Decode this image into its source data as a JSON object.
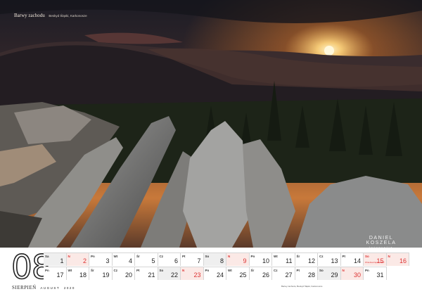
{
  "photo": {
    "caption_title": "Barwy zachodu",
    "caption_location": "Beskyd Śląski, Karkonosze",
    "author_name": "DANIEL KOSZELA",
    "author_role": "fotografia"
  },
  "calendar": {
    "month_number": "08",
    "month_name_pl": "SIERPIEŃ",
    "month_name_en": "AUGUST",
    "year": "2020",
    "row1": [
      {
        "wd": "Sa",
        "num": "1",
        "type": "sat"
      },
      {
        "wd": "N",
        "num": "2",
        "type": "sun"
      },
      {
        "wd": "Pn",
        "num": "3",
        "type": "wk"
      },
      {
        "wd": "Wt",
        "num": "4",
        "type": "wk"
      },
      {
        "wd": "Śr",
        "num": "5",
        "type": "wk"
      },
      {
        "wd": "Cz",
        "num": "6",
        "type": "wk"
      },
      {
        "wd": "Pt",
        "num": "7",
        "type": "wk"
      },
      {
        "wd": "So",
        "num": "8",
        "type": "sat"
      },
      {
        "wd": "N",
        "num": "9",
        "type": "sun"
      },
      {
        "wd": "Pn",
        "num": "10",
        "type": "wk"
      },
      {
        "wd": "Wt",
        "num": "11",
        "type": "wk"
      },
      {
        "wd": "Śr",
        "num": "12",
        "type": "wk"
      },
      {
        "wd": "Cz",
        "num": "13",
        "type": "wk"
      },
      {
        "wd": "Pt",
        "num": "14",
        "type": "wk"
      },
      {
        "wd": "So",
        "num": "15",
        "type": "hol",
        "note": "Wniebowzięcie NMP"
      },
      {
        "wd": "N",
        "num": "16",
        "type": "sun"
      }
    ],
    "row2": [
      {
        "wd": "Pn",
        "num": "17",
        "type": "wk"
      },
      {
        "wd": "Wt",
        "num": "18",
        "type": "wk"
      },
      {
        "wd": "Śr",
        "num": "19",
        "type": "wk"
      },
      {
        "wd": "Cz",
        "num": "20",
        "type": "wk"
      },
      {
        "wd": "Pt",
        "num": "21",
        "type": "wk"
      },
      {
        "wd": "So",
        "num": "22",
        "type": "sat"
      },
      {
        "wd": "N",
        "num": "23",
        "type": "sun"
      },
      {
        "wd": "Pn",
        "num": "24",
        "type": "wk"
      },
      {
        "wd": "Wt",
        "num": "25",
        "type": "wk"
      },
      {
        "wd": "Śr",
        "num": "26",
        "type": "wk"
      },
      {
        "wd": "Cz",
        "num": "27",
        "type": "wk"
      },
      {
        "wd": "Pt",
        "num": "28",
        "type": "wk"
      },
      {
        "wd": "So",
        "num": "29",
        "type": "sat"
      },
      {
        "wd": "N",
        "num": "30",
        "type": "sun"
      },
      {
        "wd": "Pn",
        "num": "31",
        "type": "wk"
      }
    ]
  },
  "footer_note": "Barwy zachodu, Beskyd Śląski, Karkonosze"
}
